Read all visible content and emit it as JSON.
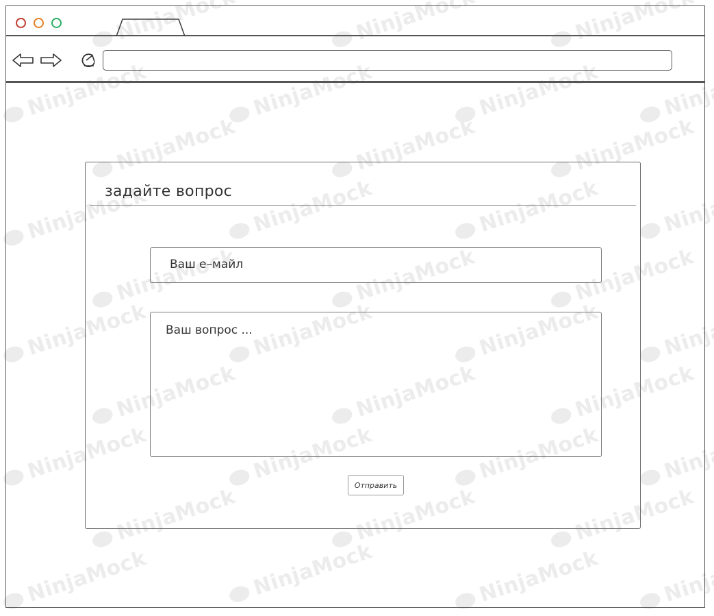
{
  "watermark": {
    "text": "NinjaMock"
  },
  "browser": {
    "traffic_lights": {
      "close_color": "#c0392b",
      "minimize_color": "#e67e22",
      "maximize_color": "#27ae60"
    },
    "tab": {
      "label": ""
    },
    "address_bar": {
      "value": ""
    },
    "icons": [
      "back-arrow-icon",
      "forward-arrow-icon",
      "reload-icon"
    ]
  },
  "dialog": {
    "title": "задайте вопрос",
    "email_placeholder": "Ваш е–майл",
    "question_placeholder": "Ваш вопрос ...",
    "send_label": "Отправить"
  }
}
